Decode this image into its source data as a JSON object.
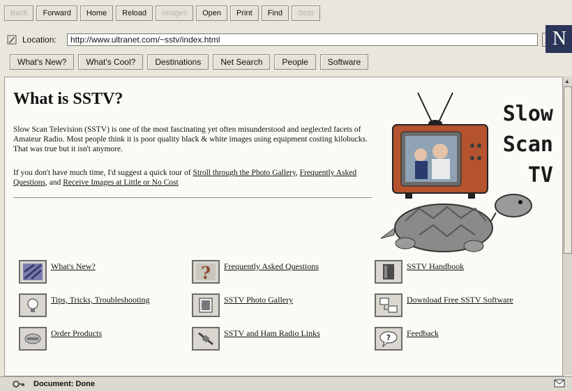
{
  "toolbar": {
    "buttons": [
      {
        "label": "Back",
        "enabled": false
      },
      {
        "label": "Forward",
        "enabled": true
      },
      {
        "label": "Home",
        "enabled": true
      },
      {
        "label": "Reload",
        "enabled": true
      },
      {
        "label": "Images",
        "enabled": false
      },
      {
        "label": "Open",
        "enabled": true
      },
      {
        "label": "Print",
        "enabled": true
      },
      {
        "label": "Find",
        "enabled": true
      },
      {
        "label": "Stop",
        "enabled": false
      }
    ]
  },
  "location": {
    "label": "Location:",
    "url": "http://www.ultranet.com/~sstv/index.html"
  },
  "logo_letter": "N",
  "directory": [
    "What's New?",
    "What's Cool?",
    "Destinations",
    "Net Search",
    "People",
    "Software"
  ],
  "page": {
    "title": "What is SSTV?",
    "intro": "Slow Scan Television (SSTV) is one of the most fascinating yet often misunderstood and neglected facets of Amateur Radio. Most people think it is poor quality black & white images using equipment costing kilobucks. That was true but it isn't anymore.",
    "intro2_prefix": "If you don't have much time, I'd suggest a quick tour of ",
    "tour_links": [
      "Stroll through the Photo Gallery",
      "Frequently Asked Questions",
      "Receive Images at Little or No Cost"
    ],
    "art_text": [
      "Slow",
      "Scan",
      "TV"
    ]
  },
  "links": [
    {
      "label": "What's New?",
      "icon": "whats-new-icon"
    },
    {
      "label": "Frequently Asked Questions",
      "icon": "question-icon"
    },
    {
      "label": "SSTV Handbook",
      "icon": "book-icon"
    },
    {
      "label": "Tips, Tricks, Troubleshooting",
      "icon": "lightbulb-icon"
    },
    {
      "label": "SSTV Photo Gallery",
      "icon": "photo-icon"
    },
    {
      "label": "Download Free SSTV Software",
      "icon": "download-icon"
    },
    {
      "label": "Order Products",
      "icon": "order-icon"
    },
    {
      "label": "SSTV and Ham Radio Links",
      "icon": "satellite-icon"
    },
    {
      "label": "Feedback",
      "icon": "feedback-icon"
    }
  ],
  "status": {
    "text": "Document: Done"
  },
  "colors": {
    "art_text": "#1a1a1a",
    "tv_body": "#b5532e",
    "turtle": "#8a8a8a"
  }
}
